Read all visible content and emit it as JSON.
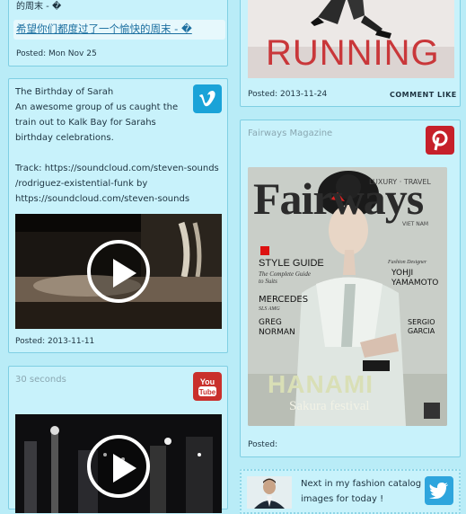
{
  "card_top": {
    "partial_title": "的周末 - �",
    "link_text": "希望你们都度过了一个愉快的周末 - �",
    "posted": "Posted: Mon Nov 25"
  },
  "card_running": {
    "image_text": "RUNNING",
    "posted": "Posted: 2013-11-24",
    "comment_label": "COMMENT",
    "like_label": "LIKE"
  },
  "card_vimeo": {
    "title": "The Birthday of Sarah",
    "body_line1": "An awesome group of us caught the",
    "body_line2": "train out to Kalk Bay for Sarahs",
    "body_line3": "birthday celebrations.",
    "track_line1": "Track: https://soundcloud.com/steven-sounds",
    "track_line2": "/rodriguez-existential-funk by",
    "track_line3": "https://soundcloud.com/steven-sounds",
    "posted": "Posted: 2013-11-11",
    "icon": "vimeo-icon"
  },
  "card_magazine": {
    "title": "Fairways Magazine",
    "cover": {
      "masthead": "Fairways",
      "tagline": "LUXURY · TRAVEL",
      "region": "VIET NAM",
      "style_guide": "STYLE GUIDE",
      "style_sub": "The Complete Guide to Suits",
      "mercedes": "MERCEDES",
      "mercedes_sub": "SLS AMG",
      "greg": "GREG NORMAN",
      "designer_label": "Fashion Designer",
      "designer_name": "YOHJI YAMAMOTO",
      "sergio": "SERGIO GARCIA",
      "hanami": "HANAMI",
      "festival": "Sakura festival"
    },
    "posted": "Posted:",
    "icon": "pinterest-icon"
  },
  "card_youtube": {
    "title": "30 seconds",
    "icon": "youtube-icon"
  },
  "card_twitter": {
    "text_line1": "Next in my fashion catalog",
    "text_line2": "images for today !",
    "icon": "twitter-icon"
  },
  "colors": {
    "background": "#b9ecf7",
    "card": "#c8f2fb",
    "border": "#7fcfe3",
    "vimeo": "#1aa3d8",
    "youtube": "#c9302c",
    "pinterest": "#c6202a",
    "twitter": "#2ea5dd"
  }
}
